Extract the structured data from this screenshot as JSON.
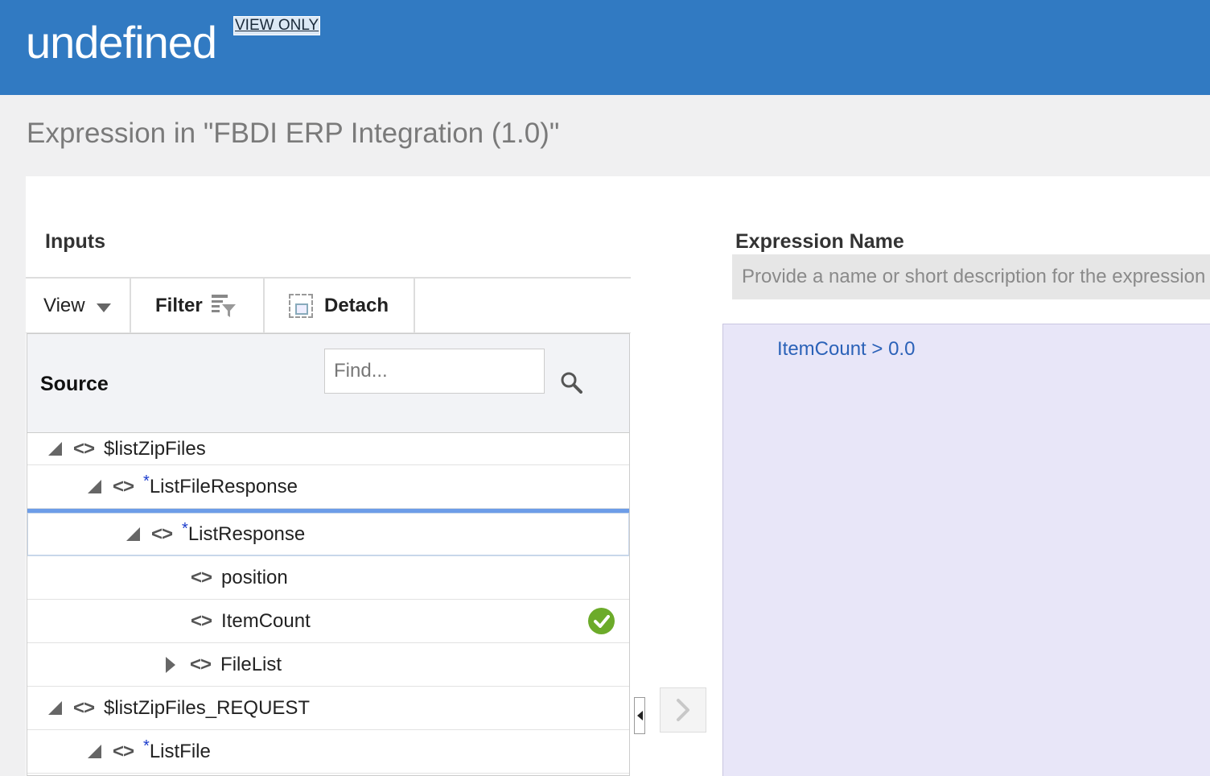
{
  "header": {
    "app_title": "undefined",
    "badge": "VIEW ONLY"
  },
  "page": {
    "heading": "Expression in \"FBDI ERP Integration (1.0)\""
  },
  "inputs": {
    "label": "Inputs",
    "toolbar": {
      "view_label": "View",
      "filter_label": "Filter",
      "detach_label": "Detach"
    },
    "source": {
      "label": "Source",
      "find_placeholder": "Find..."
    },
    "tree": {
      "row0": {
        "label": "$listZipFiles",
        "required": ""
      },
      "row1": {
        "label": "ListFileResponse",
        "required": "*"
      },
      "row2": {
        "label": "ListResponse",
        "required": "*"
      },
      "row3": {
        "label": "position",
        "required": ""
      },
      "row4": {
        "label": "ItemCount",
        "required": ""
      },
      "row5": {
        "label": "FileList",
        "required": ""
      },
      "row6": {
        "label": "$listZipFiles_REQUEST",
        "required": ""
      },
      "row7": {
        "label": "ListFile",
        "required": "*"
      }
    }
  },
  "expression": {
    "name_label": "Expression Name",
    "name_placeholder": "Provide a name or short description for the expression",
    "text": "ItemCount > 0.0"
  },
  "colors": {
    "header_bg": "#317ac2",
    "editor_bg": "#e8e6f8",
    "expression_text": "#2b62b8",
    "check_green": "#6cab2a",
    "selected_row_border": "#6d9de8"
  },
  "icons": {
    "view_caret": "chevron-down-icon",
    "filter": "filter-icon",
    "detach": "detach-icon",
    "search": "search-icon",
    "element": "code-brackets-icon",
    "mapped": "check-circle-icon",
    "collapse": "caret-left-icon",
    "insert": "chevron-right-icon"
  }
}
